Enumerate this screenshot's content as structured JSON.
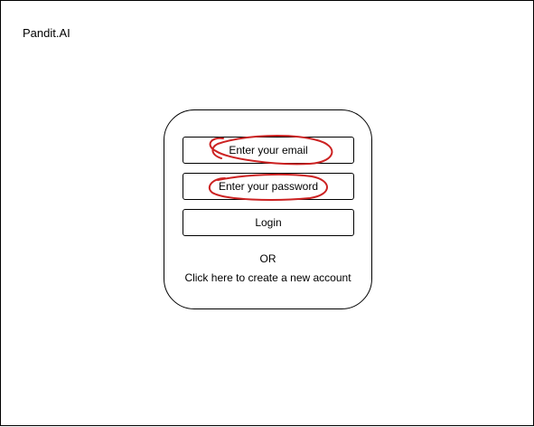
{
  "app": {
    "brand": "Pandit.AI"
  },
  "login_card": {
    "email_placeholder": "Enter your email",
    "password_placeholder": "Enter your password",
    "login_label": "Login",
    "or_text": "OR",
    "create_account_text": "Click here to create a new account"
  },
  "annotations": {
    "circle_color": "#cc2222"
  }
}
